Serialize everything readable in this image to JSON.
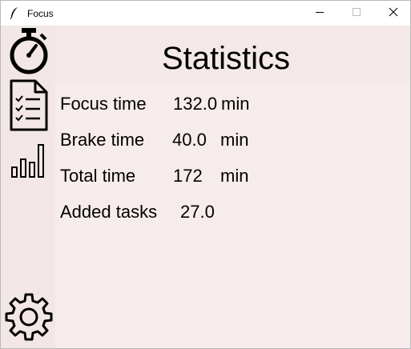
{
  "window": {
    "title": "Focus",
    "app_icon": "feather-icon",
    "controls": {
      "minimize_icon": "minimize-icon",
      "maximize_icon": "maximize-icon",
      "close_icon": "close-icon"
    }
  },
  "sidebar": {
    "items": [
      {
        "id": "timer",
        "icon": "stopwatch-icon"
      },
      {
        "id": "tasks",
        "icon": "checklist-icon"
      },
      {
        "id": "statistics",
        "icon": "bar-chart-icon"
      },
      {
        "id": "settings",
        "icon": "gear-icon"
      }
    ]
  },
  "page": {
    "title": "Statistics"
  },
  "stats": [
    {
      "label": "Focus time",
      "value": "132.0",
      "unit": "min"
    },
    {
      "label": "Brake time",
      "value": "40.0",
      "unit": "min"
    },
    {
      "label": "Total time",
      "value": "172",
      "unit": "min"
    },
    {
      "label": "Added tasks",
      "value": "27.0"
    }
  ],
  "colors": {
    "content_bg": "#f7ecec",
    "sidebar_bg": "#f2e6e6",
    "text": "#000000"
  }
}
